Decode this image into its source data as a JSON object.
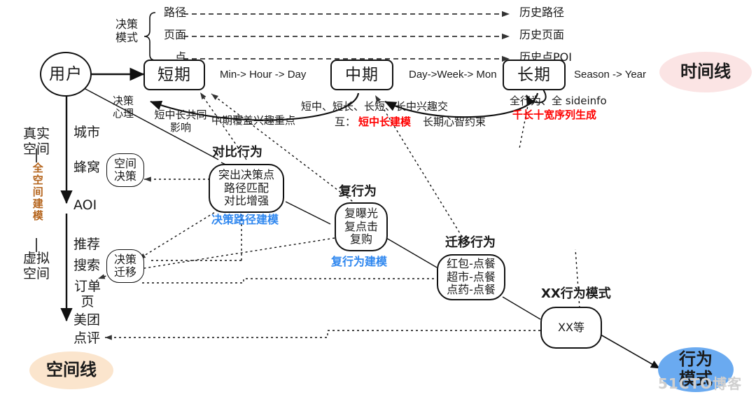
{
  "diagram": {
    "title_nodes": {
      "user": "用户",
      "short": "短期",
      "mid": "中期",
      "long": "长期"
    },
    "decision_mode": {
      "group_label": "决策\n模式",
      "rows": [
        {
          "left": "路径",
          "right": "历史路径"
        },
        {
          "left": "页面",
          "right": "历史页面"
        },
        {
          "left": "点",
          "right": "历史点POI"
        }
      ]
    },
    "timescales": {
      "short_to_mid": "Min-> Hour -> Day",
      "mid_to_long": "Day->Week-> Mon",
      "long_out": "Season -> Year"
    },
    "badges": {
      "timeline": "时间线",
      "spaceline": "空间线",
      "behavior": "行为\n模式"
    },
    "annotations": {
      "decision_psychology": "决策\n心理",
      "short_mid_long_common": "短中长共同\n影响",
      "mid_covers_interest": "中期覆盖兴趣重点",
      "cross_interest": "短中、短长、长短、长中兴趣交",
      "mutual_prefix": "互：",
      "mutual_red": "短中长建模",
      "long_mind_constraint": "长期心智约束",
      "all_behavior_sideinfo": "全行为、全 sideinfo",
      "thousand_long_red": "千长十宽序列生成"
    },
    "spatial_axis": {
      "real_space": "真实\n空间",
      "virtual_space": "虚拟\n空间",
      "full_space_model": "全空间建模",
      "upper_items": [
        "城市",
        "蜂窝",
        "AOI"
      ],
      "lower_items": [
        "推荐",
        "搜索",
        "订单\n页",
        "美团",
        "点评"
      ]
    },
    "nodes": {
      "space_decision": "空间\n决策",
      "decision_migration": "决策\n迁移",
      "contrast_behavior_title": "对比行为",
      "contrast_behavior_body": "突出决策点\n路径匹配\n对比增强",
      "contrast_behavior_caption": "决策路径建模",
      "repeat_behavior_title": "复行为",
      "repeat_behavior_body": "复曝光\n复点击\n复购",
      "repeat_behavior_caption": "复行为建模",
      "migration_behavior_title": "迁移行为",
      "migration_behavior_body": "红包-点餐\n超市-点餐\n点药-点餐",
      "xx_pattern_title": "XX行为模式",
      "xx_pattern_body": "XX等"
    },
    "watermark": "51CTO博客",
    "colors": {
      "timeline_badge": "#fbe4e4",
      "spaceline_badge": "#fbe5cd",
      "behavior_badge": "#6aaaf0",
      "red_highlight": "#ff0000",
      "blue_caption": "#2f87ef",
      "orange_axis": "#b5651d",
      "stroke": "#111111"
    }
  }
}
